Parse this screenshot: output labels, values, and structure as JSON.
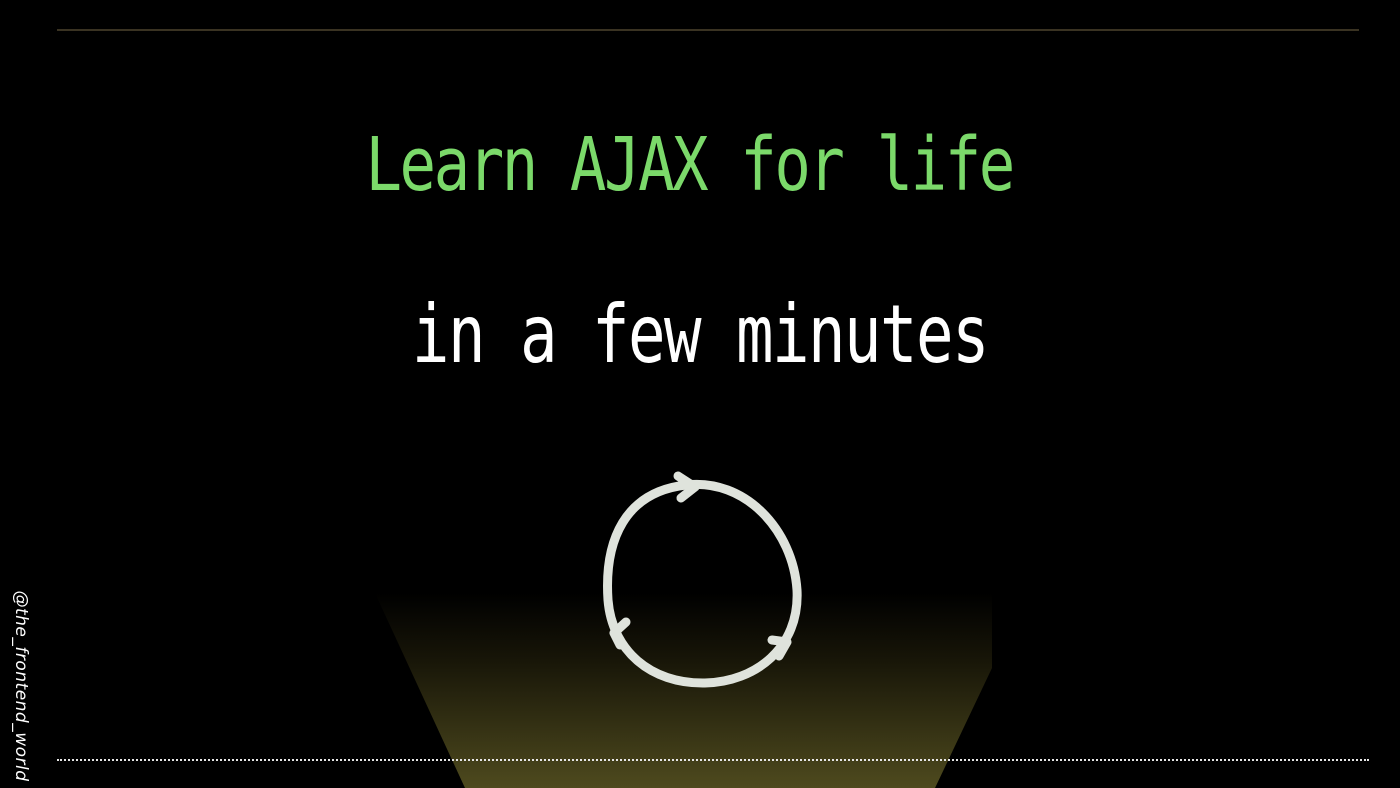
{
  "slide": {
    "title": "Learn AJAX for life",
    "subtitle": "in a few minutes",
    "handle": "@the_frontend_world"
  },
  "colors": {
    "background": "#000000",
    "title": "#7bd96a",
    "subtitle": "#ffffff",
    "cycle_stroke": "#dfe3dc",
    "spotlight_base": "#4e4a1e",
    "top_rule": "#3a3322",
    "bottom_rule": "#e6e6e6"
  },
  "icons": {
    "cycle": "circular-arrows-cycle-icon"
  }
}
